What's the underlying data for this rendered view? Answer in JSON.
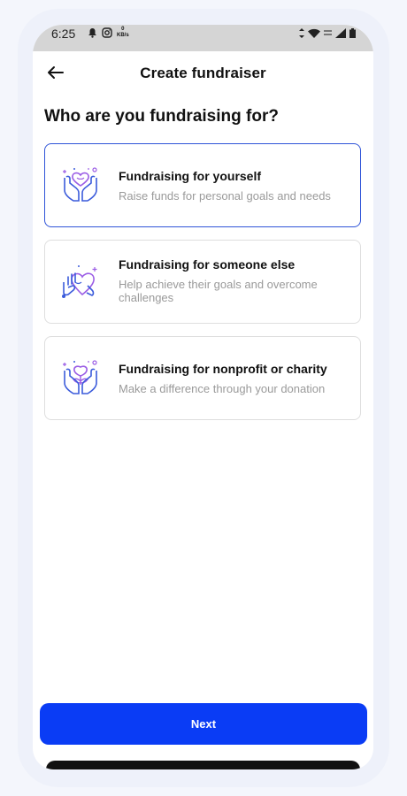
{
  "status_bar": {
    "time": "6:25",
    "speed_value": "0",
    "speed_unit": "KB/s"
  },
  "header": {
    "title": "Create fundraiser"
  },
  "question": "Who are you fundraising for?",
  "options": [
    {
      "title": "Fundraising for yourself",
      "description": "Raise funds for personal goals and needs",
      "icon": "hands-heart-icon",
      "selected": true
    },
    {
      "title": "Fundraising for someone else",
      "description": "Help achieve their goals and overcome challenges",
      "icon": "helping-hand-icon",
      "selected": false
    },
    {
      "title": "Fundraising for nonprofit or charity",
      "description": "Make a difference through your donation",
      "icon": "hands-plant-icon",
      "selected": false
    }
  ],
  "next_button": {
    "label": "Next"
  },
  "colors": {
    "accent": "#0a3cf5",
    "selected_border": "#2f54d8",
    "icon_blue": "#3b5bdb",
    "icon_purple": "#9b5de5"
  }
}
